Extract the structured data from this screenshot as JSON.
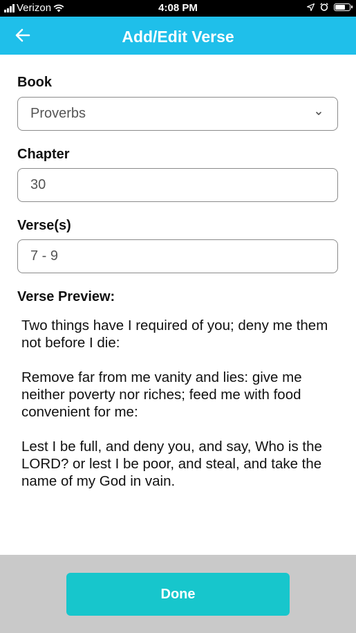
{
  "status_bar": {
    "carrier": "Verizon",
    "time": "4:08 PM",
    "icons": [
      "signal-icon",
      "wifi-icon",
      "location-icon",
      "alarm-icon",
      "battery-icon"
    ]
  },
  "header": {
    "title": "Add/Edit Verse",
    "back_icon": "arrow-left-icon",
    "background_color": "#1fbfea"
  },
  "form": {
    "book_label": "Book",
    "book_value": "Proverbs",
    "chapter_label": "Chapter",
    "chapter_value": "30",
    "verses_label": "Verse(s)",
    "verses_value": "7 - 9"
  },
  "preview": {
    "label": "Verse Preview:",
    "paragraphs": [
      "Two things have I required of you; deny me them not before I die:",
      "Remove far from me vanity and lies: give me neither poverty nor riches; feed me with food convenient for me:",
      "Lest I be full, and deny you, and say, Who is the LORD? or lest I be poor, and steal, and take the name of my God in vain."
    ]
  },
  "footer": {
    "done_label": "Done",
    "button_color": "#17c6cc"
  }
}
